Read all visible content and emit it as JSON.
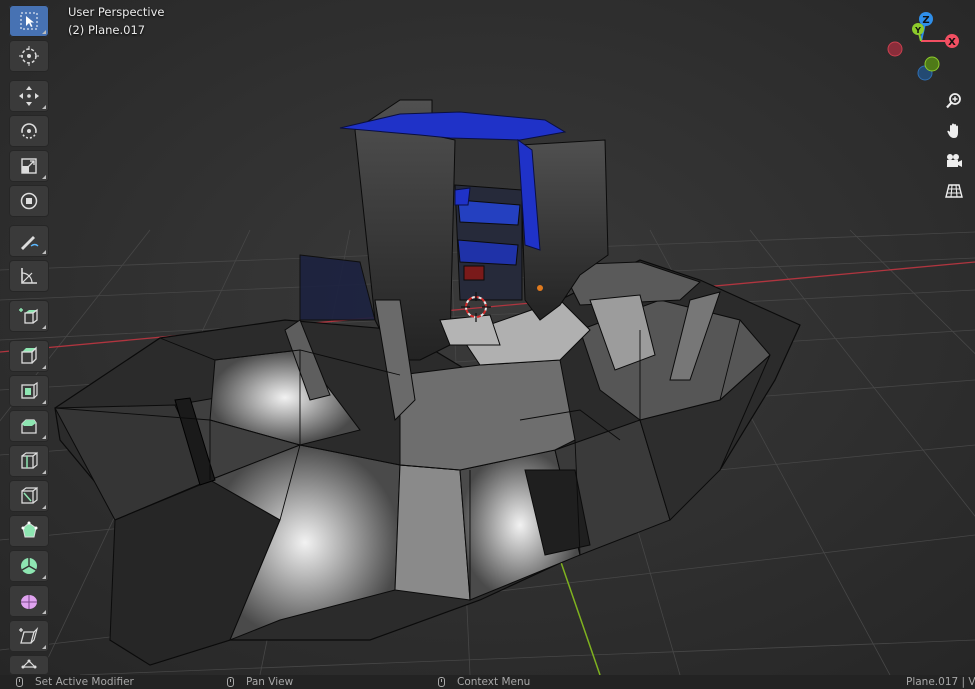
{
  "viewport": {
    "perspective_label": "User Perspective",
    "object_label": "(2) Plane.017"
  },
  "toolbar": {
    "tools": [
      {
        "name": "select-box",
        "icon": "select-box-icon",
        "active": true
      },
      {
        "name": "cursor",
        "icon": "cursor-icon"
      },
      {
        "name": "move",
        "icon": "move-icon"
      },
      {
        "name": "rotate",
        "icon": "rotate-icon"
      },
      {
        "name": "scale",
        "icon": "scale-icon"
      },
      {
        "name": "transform",
        "icon": "transform-icon"
      },
      {
        "name": "annotate",
        "icon": "annotate-icon"
      },
      {
        "name": "measure",
        "icon": "measure-icon"
      },
      {
        "name": "add-cube",
        "icon": "add-cube-icon"
      },
      {
        "name": "extrude-region",
        "icon": "extrude-region-icon"
      },
      {
        "name": "inset-faces",
        "icon": "inset-faces-icon"
      },
      {
        "name": "bevel",
        "icon": "bevel-icon"
      },
      {
        "name": "loop-cut",
        "icon": "loop-cut-icon"
      },
      {
        "name": "knife",
        "icon": "knife-icon"
      },
      {
        "name": "poly-build",
        "icon": "poly-build-icon"
      },
      {
        "name": "spin",
        "icon": "spin-icon"
      },
      {
        "name": "smooth",
        "icon": "smooth-icon"
      },
      {
        "name": "shear",
        "icon": "shear-icon"
      },
      {
        "name": "rip-region",
        "icon": "rip-region-icon"
      }
    ]
  },
  "gizmo": {
    "axes": {
      "z": "Z",
      "y": "Y",
      "x": "X"
    },
    "colors": {
      "x": "#f24f62",
      "y": "#8dcb2c",
      "z": "#2f8fea"
    }
  },
  "nav_buttons": [
    "zoom-icon",
    "pan-hand-icon",
    "camera-icon",
    "grid-icon"
  ],
  "statusbar": {
    "set_active_modifier": "Set Active Modifier",
    "pan_view": "Pan View",
    "context_menu": "Context Menu",
    "right_info": "Plane.017 | V"
  },
  "colors": {
    "active_tool": "#4772b3",
    "x_axis_line": "#b0353f",
    "y_axis_line": "#7fb21f",
    "blue_material": "#1f32c8"
  }
}
